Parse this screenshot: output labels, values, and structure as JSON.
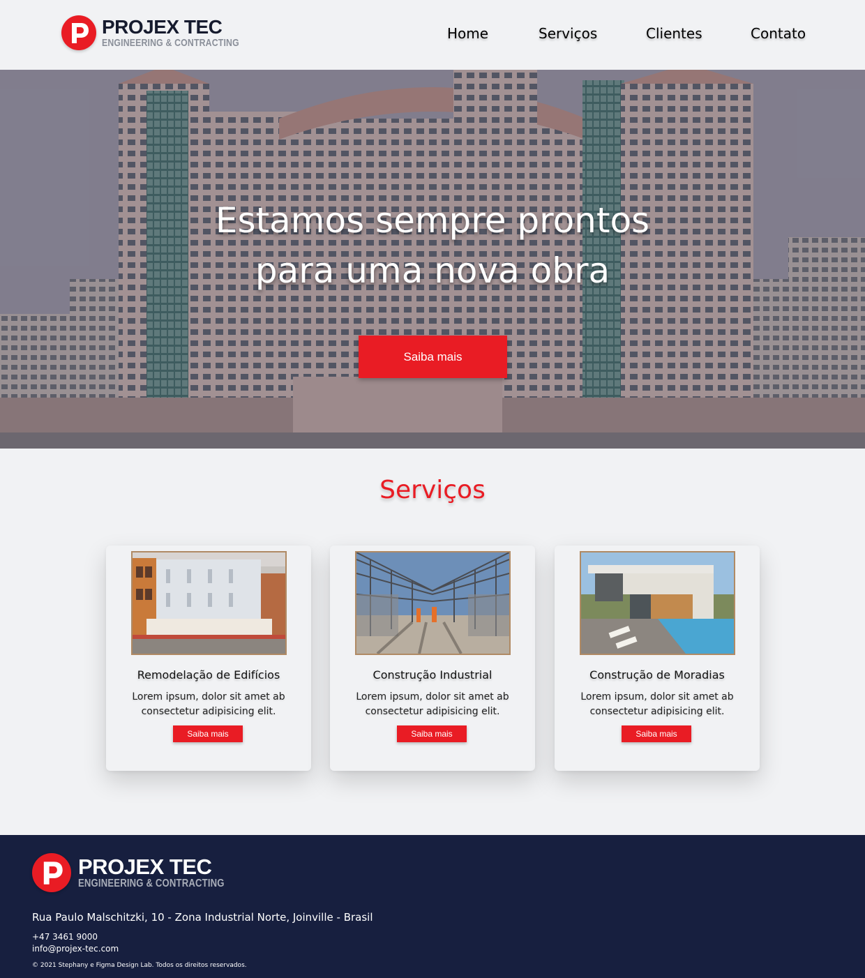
{
  "brand": {
    "name": "PROJEX TEC",
    "tagline": "ENGINEERING & CONTRACTING",
    "accent_color": "#e91c24",
    "dark_color": "#171f3f"
  },
  "nav": {
    "items": [
      "Home",
      "Serviços",
      "Clientes",
      "Contato"
    ]
  },
  "hero": {
    "title_line1": "Estamos sempre prontos",
    "title_line2": "para uma nova obra",
    "button_label": "Saiba mais"
  },
  "services": {
    "title": "Serviços",
    "cards": [
      {
        "title": "Remodelação de Edifícios",
        "desc_line1": "Lorem ipsum, dolor sit amet ab",
        "desc_line2": "consectetur adipisicing elit.",
        "button_label": "Saiba mais",
        "image_icon": "building-renovation-photo"
      },
      {
        "title": "Construção Industrial",
        "desc_line1": "Lorem ipsum, dolor sit amet ab",
        "desc_line2": "consectetur adipisicing elit.",
        "button_label": "Saiba mais",
        "image_icon": "steel-structure-photo"
      },
      {
        "title": "Construção de Moradias",
        "desc_line1": "Lorem ipsum, dolor sit amet ab",
        "desc_line2": "consectetur adipisicing elit.",
        "button_label": "Saiba mais",
        "image_icon": "modern-house-photo"
      }
    ]
  },
  "footer": {
    "address": "Rua Paulo Malschitzki, 10 - Zona Industrial Norte, Joinville - Brasil",
    "phone": "+47 3461 9000",
    "email": "info@projex-tec.com",
    "copyright": "© 2021 Stephany e Figma Design Lab. Todos os direitos reservados."
  }
}
